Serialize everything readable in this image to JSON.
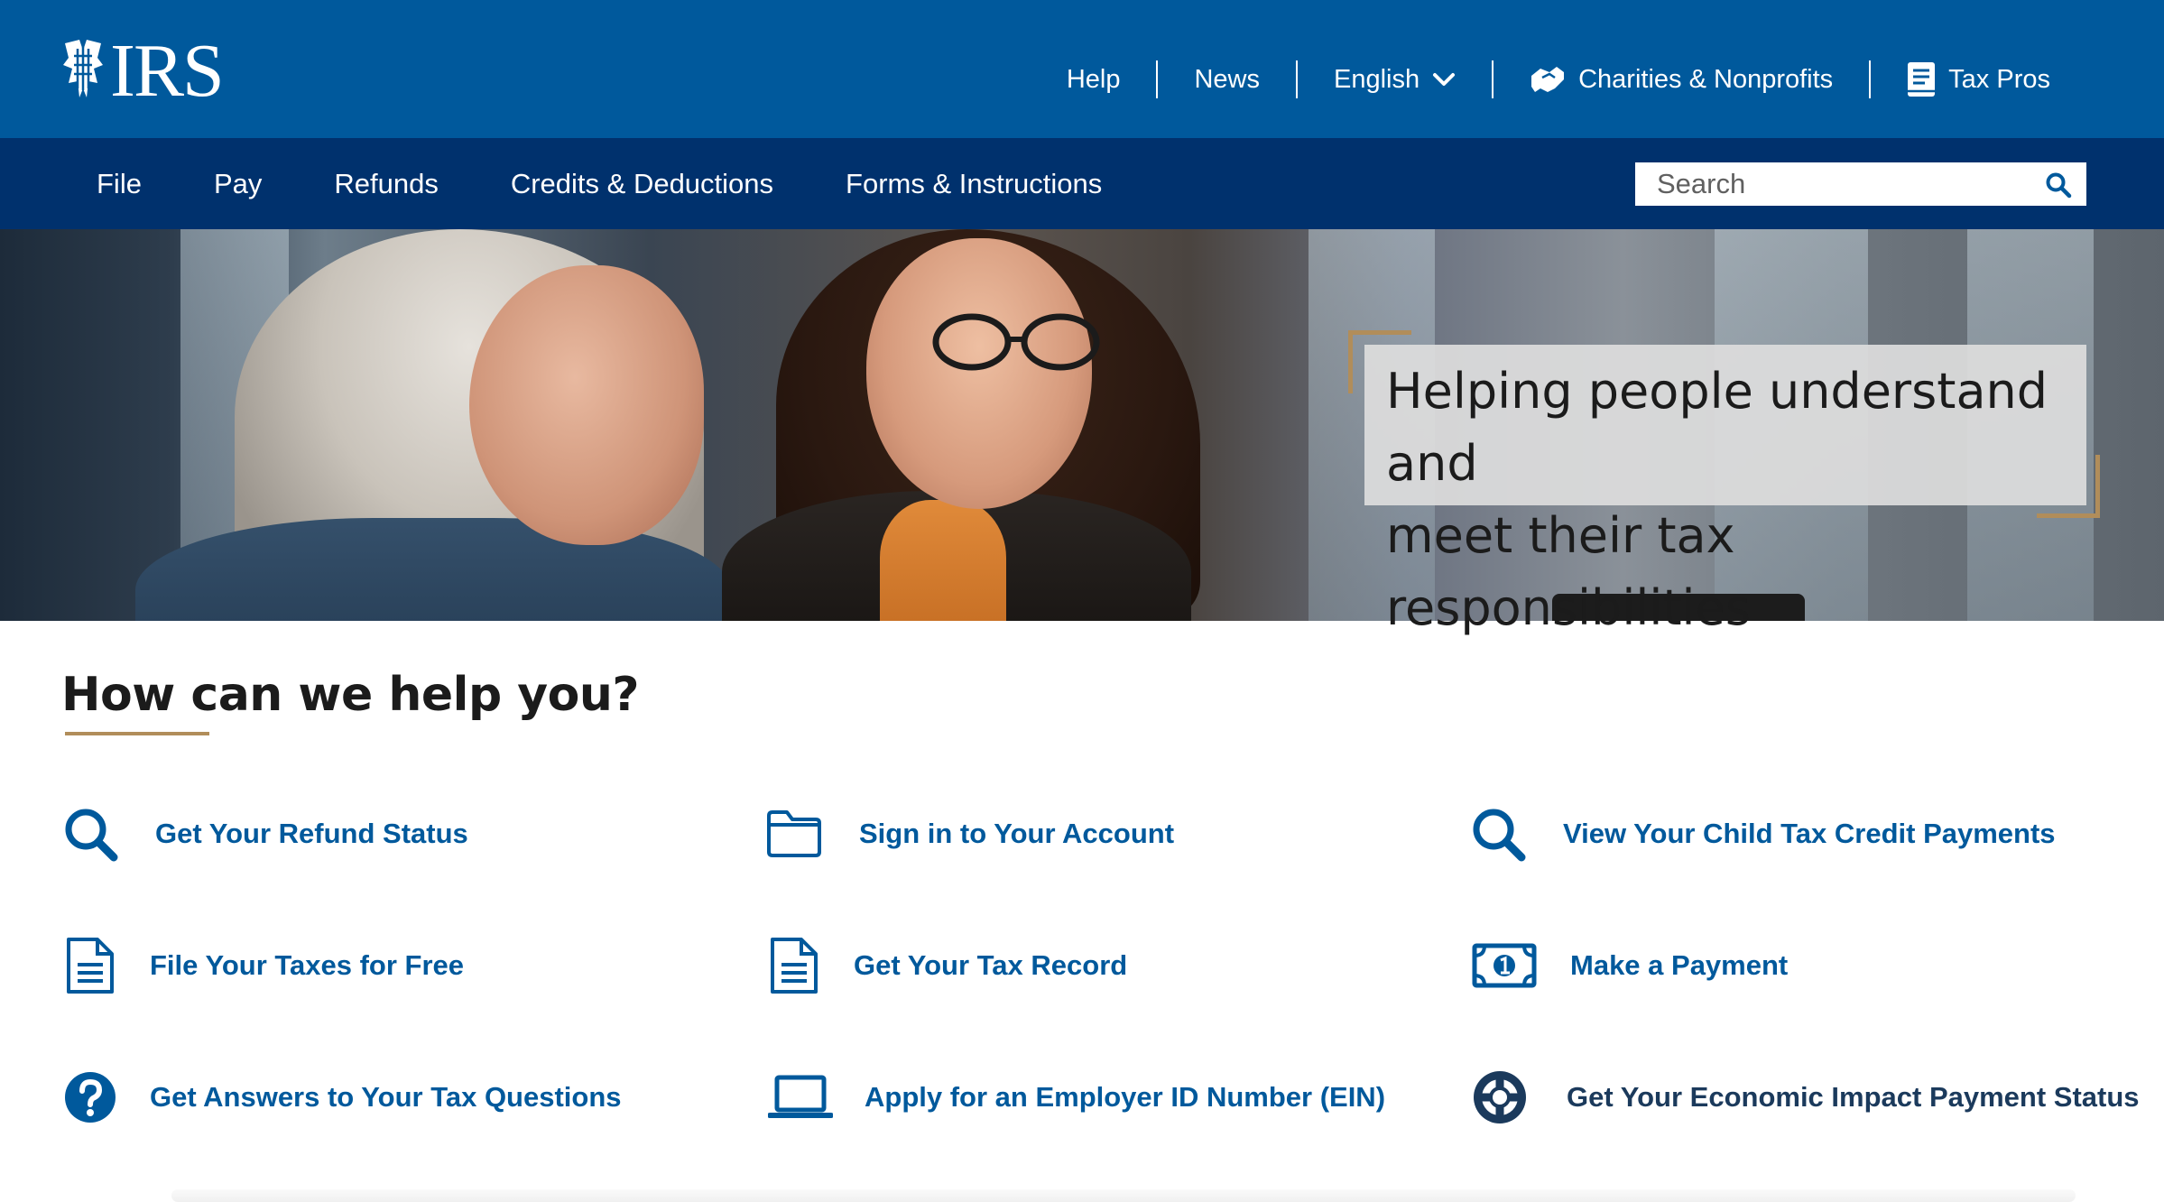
{
  "header": {
    "logo_text": "IRS",
    "links": [
      {
        "label": "Help"
      },
      {
        "label": "News"
      },
      {
        "label": "English"
      },
      {
        "label": "Charities & Nonprofits"
      },
      {
        "label": "Tax Pros"
      }
    ]
  },
  "nav": {
    "items": [
      {
        "label": "File"
      },
      {
        "label": "Pay"
      },
      {
        "label": "Refunds"
      },
      {
        "label": "Credits & Deductions"
      },
      {
        "label": "Forms & Instructions"
      }
    ],
    "search_placeholder": "Search"
  },
  "hero": {
    "caption_line1": "Helping people understand and",
    "caption_line2": "meet their tax responsibilities"
  },
  "help": {
    "title": "How can we help you?",
    "tasks": [
      {
        "label": "Get Your Refund Status",
        "icon": "search-icon"
      },
      {
        "label": "Sign in to Your Account",
        "icon": "folder-icon"
      },
      {
        "label": "View Your Child Tax Credit Payments",
        "icon": "search-icon"
      },
      {
        "label": "File Your Taxes for Free",
        "icon": "document-icon"
      },
      {
        "label": "Get Your Tax Record",
        "icon": "document-icon"
      },
      {
        "label": "Make a Payment",
        "icon": "money-icon"
      },
      {
        "label": "Get Answers to Your Tax Questions",
        "icon": "question-icon"
      },
      {
        "label": "Apply for an Employer ID Number (EIN)",
        "icon": "laptop-icon"
      },
      {
        "label": "Get Your Economic Impact Payment Status",
        "icon": "lifebuoy-icon"
      }
    ]
  },
  "colors": {
    "header_blue": "#00599c",
    "nav_navy": "#00316d",
    "accent_gold": "#b18d5a",
    "link_blue": "#00599c"
  }
}
